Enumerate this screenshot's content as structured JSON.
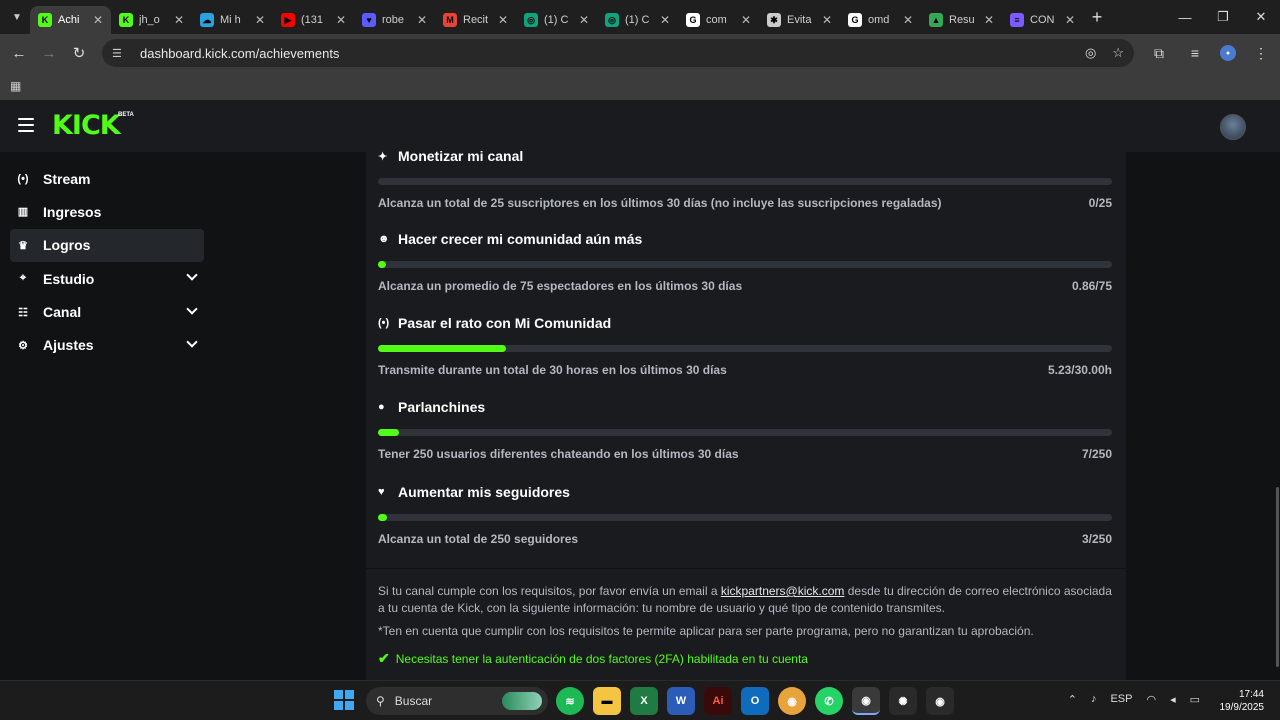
{
  "browser": {
    "tabs": [
      {
        "label": "Achi",
        "fav": "K",
        "color": "#53fc18",
        "active": true
      },
      {
        "label": "jh_o",
        "fav": "K",
        "color": "#53fc18"
      },
      {
        "label": "Mi h",
        "fav": "☁",
        "color": "#29a3e0"
      },
      {
        "label": "(131",
        "fav": "▶",
        "color": "#ff0000"
      },
      {
        "label": "robe",
        "fav": "♥",
        "color": "#5b5bff"
      },
      {
        "label": "Recit",
        "fav": "M",
        "color": "#ea4335"
      },
      {
        "label": "(1) C",
        "fav": "◎",
        "color": "#10a37f"
      },
      {
        "label": "(1) C",
        "fav": "◎",
        "color": "#10a37f"
      },
      {
        "label": "com",
        "fav": "G",
        "color": "#ffffff"
      },
      {
        "label": "Evita",
        "fav": "✱",
        "color": "#cccccc"
      },
      {
        "label": "omd",
        "fav": "G",
        "color": "#ffffff"
      },
      {
        "label": "Resu",
        "fav": "▲",
        "color": "#34a853"
      },
      {
        "label": "CON",
        "fav": "≡",
        "color": "#7b5cff"
      }
    ],
    "url": "dashboard.kick.com/achievements"
  },
  "header": {
    "logo": "KICK",
    "beta": "BETA"
  },
  "sidebar": {
    "items": [
      {
        "label": "Stream",
        "icon": "(•)"
      },
      {
        "label": "Ingresos",
        "icon": "▥"
      },
      {
        "label": "Logros",
        "icon": "♛"
      },
      {
        "label": "Estudio",
        "icon": "⌖"
      },
      {
        "label": "Canal",
        "icon": "☷"
      },
      {
        "label": "Ajustes",
        "icon": "⚙"
      }
    ]
  },
  "achievements": [
    {
      "title": "Monetizar mi canal",
      "icon": "✦",
      "desc": "Alcanza un total de 25 suscriptores en los últimos 30 días (no incluye las suscripciones regaladas)",
      "value": "0/25",
      "progress": 0
    },
    {
      "title": "Hacer crecer mi comunidad aún más",
      "icon": "☻",
      "desc": "Alcanza un promedio de 75 espectadores en los últimos 30 días",
      "value": "0.86/75",
      "progress": 0.0115
    },
    {
      "title": "Pasar el rato con Mi Comunidad",
      "icon": "(•)",
      "desc": "Transmite durante un total de 30 horas en los últimos 30 días",
      "value": "5.23/30.00h",
      "progress": 0.1743
    },
    {
      "title": "Parlanchines",
      "icon": "●",
      "desc": "Tener 250 usuarios diferentes chateando en los últimos 30 días",
      "value": "7/250",
      "progress": 0.028
    },
    {
      "title": "Aumentar mis seguidores",
      "icon": "♥",
      "desc": "Alcanza un total de 250 seguidores",
      "value": "3/250",
      "progress": 0.012
    }
  ],
  "info": {
    "before": "Si tu canal cumple con los requisitos, por favor envía un email a ",
    "email": "kickpartners@kick.com",
    "after": " desde tu dirección de correo electrónico asociada a tu cuenta de Kick, con la siguiente información: tu nombre de usuario y qué tipo de contenido transmites.",
    "note": "*Ten en cuenta que cumplir con los requisitos te permite aplicar para ser parte programa, pero no garantizan tu aprobación.",
    "twofa": "Necesitas tener la autenticación de dos factores (2FA) habilitada en tu cuenta"
  },
  "taskbar": {
    "search": "Buscar",
    "lang": "ESP",
    "time": "17:44",
    "date": "19/9/2025"
  }
}
